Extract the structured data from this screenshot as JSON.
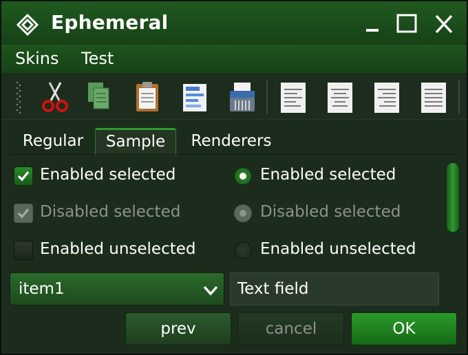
{
  "window": {
    "title": "Ephemeral"
  },
  "menu": {
    "items": [
      "Skins",
      "Test"
    ]
  },
  "toolbar": {
    "buttons": [
      "cut-icon",
      "copy-icon",
      "paste-icon",
      "properties-icon",
      "shredder-icon",
      "align-left-icon",
      "align-center-icon",
      "align-right-icon",
      "align-justify-icon"
    ]
  },
  "tabs": [
    {
      "label": "Regular",
      "selected": false
    },
    {
      "label": "Sample",
      "selected": true
    },
    {
      "label": "Renderers",
      "selected": false
    }
  ],
  "checkboxes": [
    {
      "label": "Enabled selected",
      "checked": true,
      "enabled": true
    },
    {
      "label": "Disabled selected",
      "checked": true,
      "enabled": false
    },
    {
      "label": "Enabled unselected",
      "checked": false,
      "enabled": true
    }
  ],
  "radios": [
    {
      "label": "Enabled selected",
      "checked": true,
      "enabled": true
    },
    {
      "label": "Disabled selected",
      "checked": true,
      "enabled": false
    },
    {
      "label": "Enabled unselected",
      "checked": false,
      "enabled": true
    }
  ],
  "combo": {
    "value": "item1"
  },
  "textfield": {
    "value": "Text field"
  },
  "buttons": {
    "prev": "prev",
    "cancel": "cancel",
    "ok": "OK"
  },
  "colors": {
    "accent": "#2f9a2f",
    "background": "#1c2c1c",
    "disabled_text": "#8a948a"
  }
}
